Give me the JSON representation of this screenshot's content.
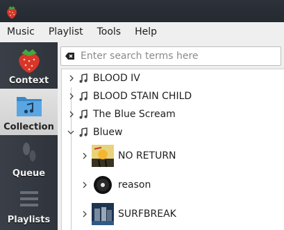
{
  "menu": [
    "Music",
    "Playlist",
    "Tools",
    "Help"
  ],
  "sidebar": {
    "items": [
      {
        "label": "Context",
        "icon": "strawberry-icon",
        "active": false
      },
      {
        "label": "Collection",
        "icon": "folder-music-icon",
        "active": true
      },
      {
        "label": "Queue",
        "icon": "footprints-icon",
        "active": false
      },
      {
        "label": "Playlists",
        "icon": "list-icon",
        "active": false
      }
    ]
  },
  "search": {
    "placeholder": "Enter search terms here",
    "value": ""
  },
  "tree": {
    "artists": [
      {
        "name": "BLOOD IV",
        "expanded": false
      },
      {
        "name": "BLOOD STAIN CHILD",
        "expanded": false
      },
      {
        "name": "The Blue Scream",
        "expanded": false
      },
      {
        "name": "Bluew",
        "expanded": true
      }
    ],
    "albums": [
      {
        "name": "NO RETURN"
      },
      {
        "name": "reason"
      },
      {
        "name": "SURFBREAK"
      }
    ]
  },
  "colors": {
    "accent": "#e03c31",
    "sidebar": "#353a42"
  }
}
